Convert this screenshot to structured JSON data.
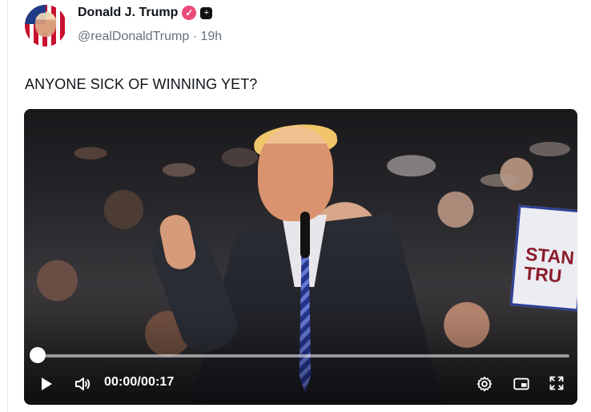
{
  "post": {
    "display_name": "Donald J. Trump",
    "handle": "@realDonaldTrump",
    "separator": "·",
    "time_ago": "19h",
    "text": "ANYONE SICK OF WINNING YET?",
    "badges": {
      "verified_icon": "verified-badge-icon",
      "plus_icon": "plus-badge-icon",
      "verified_color": "#ea4b7a"
    }
  },
  "video": {
    "current_time": "00:00",
    "duration_separator": "/",
    "duration": "00:17",
    "progress_fraction": 0.0,
    "controls": {
      "play_icon": "play-icon",
      "volume_icon": "volume-icon",
      "settings_icon": "gear-icon",
      "pip_icon": "picture-in-picture-icon",
      "fullscreen_icon": "fullscreen-icon"
    }
  }
}
